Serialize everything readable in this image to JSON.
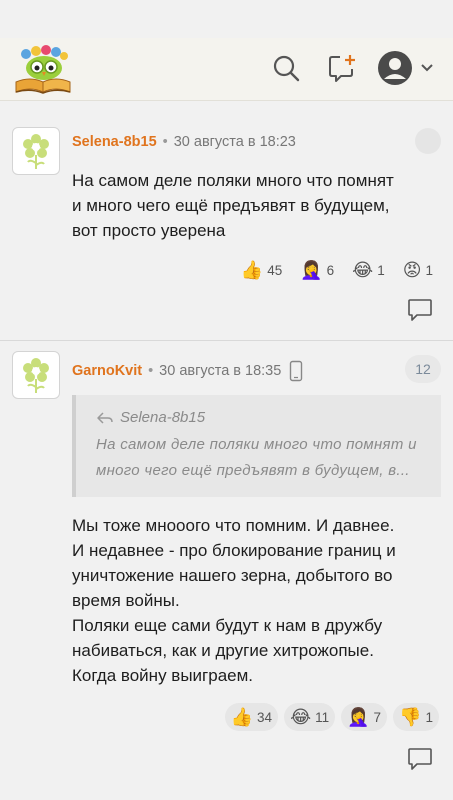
{
  "header": {
    "logo": "owl-reading-logo",
    "icons": [
      "search-icon",
      "add-comment-icon",
      "user-icon",
      "chevron-down-icon"
    ]
  },
  "comments": [
    {
      "author": "Selena-8b15",
      "time": "30 августа в 18:23",
      "text": [
        "На самом деле поляки много что помнят",
        "и много чего ещё предъявят в будущем,",
        "вот просто уверена"
      ],
      "reactions": [
        {
          "emoji": "👍",
          "icon": "thumbs-up-icon",
          "count": "45"
        },
        {
          "emoji": "🤦‍♀️",
          "icon": "facepalm-icon",
          "count": "6"
        },
        {
          "emoji": "😂",
          "icon": "laughing-icon",
          "count": "1"
        },
        {
          "emoji": "😡",
          "icon": "angry-icon",
          "count": "1"
        }
      ]
    },
    {
      "author": "GarnoKvit",
      "time": "30 августа в 18:35",
      "reply_count": "12",
      "quote": {
        "author": "Selena-8b15",
        "text": [
          "На самом деле поляки много что помнят и",
          "много чего ещё предъявят в будущем, в..."
        ]
      },
      "text": [
        "Мы тоже мнооого что помним. И давнее.",
        "И недавнее - про блокирование границ и",
        "уничтожение нашего зерна, добытого во",
        "время войны.",
        "Поляки еще сами будут к нам в дружбу",
        "набиваться, как и другие хитрожопые.",
        "Когда войну выиграем."
      ],
      "reactions": [
        {
          "emoji": "👍",
          "icon": "thumbs-up-icon",
          "count": "34"
        },
        {
          "emoji": "😂",
          "icon": "laughing-icon",
          "count": "11"
        },
        {
          "emoji": "🤦‍♀️",
          "icon": "facepalm-icon",
          "count": "7"
        },
        {
          "emoji": "👎",
          "icon": "thumbs-down-icon",
          "count": "1"
        }
      ]
    }
  ],
  "colors": {
    "author": "#e0741e",
    "background": "#f1f1f1",
    "header": "#f4f3ee"
  }
}
